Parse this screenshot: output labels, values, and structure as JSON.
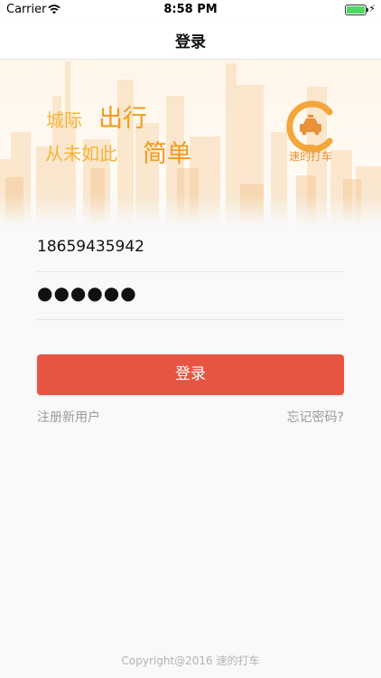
{
  "status_bar": {
    "carrier": "Carrier",
    "time": "8:58 PM",
    "battery_level": 1.0
  },
  "nav": {
    "title": "登录"
  },
  "banner": {
    "slogan_line1_small": "城际",
    "slogan_line1_large": "出行",
    "slogan_line2_small": "从未如此",
    "slogan_line2_large": "简单",
    "logo_text": "速的打车"
  },
  "form": {
    "phone_value": "18659435942",
    "password_mask": "●●●●●●"
  },
  "actions": {
    "login_label": "登录",
    "register_label": "注册新用户",
    "forgot_label": "忘记密码?"
  },
  "footer": {
    "copyright": "Copyright@2016 速的打车"
  },
  "colors": {
    "primary_button": "#e75441",
    "slogan": "#f49a1d",
    "battery": "#4cd964"
  },
  "icons": [
    "wifi-icon",
    "battery-icon",
    "charging-icon",
    "taxi-logo-icon"
  ]
}
